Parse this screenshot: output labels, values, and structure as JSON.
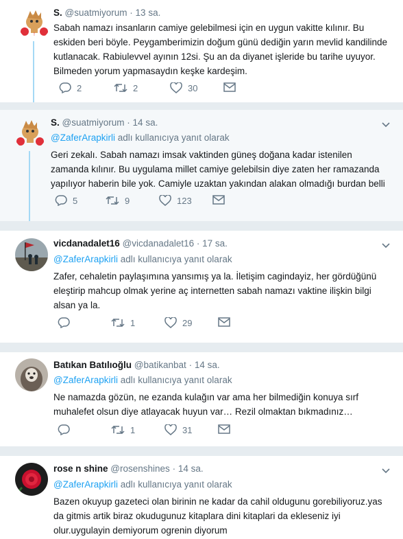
{
  "tweets": [
    {
      "name": "S.",
      "handle": "@suatmiyorum",
      "sep": "·",
      "time": "13 sa.",
      "body": "Sabah namazı insanların camiye gelebilmesi için en uygun vakitte kılınır. Bu eskiden beri böyle. Peygamberimizin doğum günü dediğin yarın mevlid kandilinde kutlanacak. Rabiulevvel ayının 12si. Şu an da diyanet işleride bu tarihe uyuyor. Bilmeden yorum yapmasaydın keşke kardeşim.",
      "reply_count": "2",
      "retweet_count": "2",
      "like_count": "30"
    },
    {
      "name": "S.",
      "handle": "@suatmiyorum",
      "sep": "·",
      "time": "14 sa.",
      "reply_mention": "@ZaferArapkirli",
      "reply_suffix": " adlı kullanıcıya yanıt olarak",
      "body": "Geri zekalı. Sabah namazı imsak vaktinden güneş doğana kadar istenilen zamanda kılınır. Bu uygulama millet camiye gelebilsin diye zaten her ramazanda yapılıyor haberin bile yok. Camiyle uzaktan yakından alakan olmadığı burdan belli",
      "reply_count": "5",
      "retweet_count": "9",
      "like_count": "123"
    },
    {
      "name": "vicdanadalet16",
      "handle": "@vicdanadalet16",
      "sep": "·",
      "time": "17 sa.",
      "reply_mention": "@ZaferArapkirli",
      "reply_suffix": " adlı kullanıcıya yanıt olarak",
      "body": "Zafer, cehaletin paylaşımına yansımış ya la. İletişim cagindayiz, her gördüğünü eleştirip mahcup olmak yerine aç internetten sabah namazı vaktine ilişkin bilgi alsan ya la.",
      "reply_count": "",
      "retweet_count": "1",
      "like_count": "29"
    },
    {
      "name": "Batıkan Batılıoğlu",
      "handle": "@batikanbat",
      "sep": "·",
      "time": "14 sa.",
      "reply_mention": "@ZaferArapkirli",
      "reply_suffix": " adlı kullanıcıya yanıt olarak",
      "body": "Ne namazda gözün, ne ezanda kulağın var ama her bilmediğin konuya sırf muhalefet olsun diye atlayacak huyun var… Rezil olmaktan bıkmadınız…",
      "reply_count": "",
      "retweet_count": "1",
      "like_count": "31"
    },
    {
      "name": "rose n shine",
      "handle": "@rosenshines",
      "sep": "·",
      "time": "14 sa.",
      "reply_mention": "@ZaferArapkirli",
      "reply_suffix": " adlı kullanıcıya yanıt olarak",
      "body": "Bazen okuyup gazeteci olan birinin ne kadar da cahil oldugunu gorebiliyoruz.yas da gitmis artik biraz okudugunuz kitaplara dini kitaplari da ekleseniz iyi olur.uygulayin demiyorum ogrenin diyorum"
    }
  ],
  "icons": {
    "reply": "reply-icon",
    "retweet": "retweet-icon",
    "like": "heart-icon",
    "dm": "envelope-icon",
    "menu": "chevron-down-icon"
  },
  "colors": {
    "link": "#1da1f2",
    "muted": "#657786",
    "thread": "#a4d9f5",
    "highlight_bg": "#f5f8fa",
    "separator_bg": "#e6ecf0"
  }
}
